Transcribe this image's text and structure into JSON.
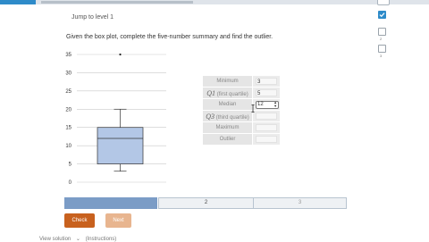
{
  "header": {
    "jump_label": "Jump to level 1",
    "prompt": "Given the box plot, complete the five-number summary and find the outlier."
  },
  "chart_data": {
    "type": "boxplot",
    "ylim": [
      0,
      35
    ],
    "yticks": [
      0,
      5,
      10,
      15,
      20,
      25,
      30,
      35
    ],
    "grid": true,
    "legend": "none",
    "minimum": 3,
    "q1": 5,
    "median": 12,
    "q3": 15,
    "maximum": 20,
    "outlier": 35
  },
  "summary": {
    "rows": [
      {
        "var": "",
        "label": "Minimum",
        "value": "3",
        "control": "input"
      },
      {
        "var": "Q1",
        "label": " (first quartile)",
        "value": "5",
        "control": "input"
      },
      {
        "var": "",
        "label": "Median",
        "value": "12",
        "control": "stepper"
      },
      {
        "var": "Q3",
        "label": " (third quartile)",
        "value": "",
        "control": "input"
      },
      {
        "var": "",
        "label": "Maximum",
        "value": "",
        "control": "input"
      },
      {
        "var": "",
        "label": "Outlier",
        "value": "",
        "control": "input"
      }
    ]
  },
  "sidebar": {
    "level_numbers": [
      "1",
      "2",
      "3"
    ]
  },
  "progress": {
    "completed_fraction": 0.33,
    "segments": [
      "1",
      "2",
      "3"
    ]
  },
  "buttons": {
    "check": "Check",
    "next": "Next"
  },
  "footer": {
    "left": "View solution",
    "right": "(Instructions)"
  },
  "colors": {
    "accent": "#2e8bc9",
    "box_fill": "#b3c7e6",
    "check_button": "#c8611e",
    "next_button": "#e8b58f",
    "progress_fill": "#7b9cc6"
  }
}
